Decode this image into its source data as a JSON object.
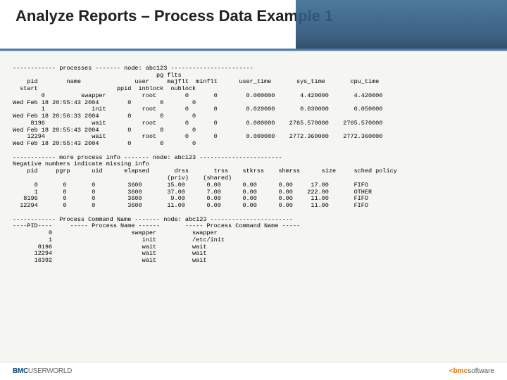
{
  "title": "Analyze Reports – Process Data Example 1",
  "block1_header": "------------ processes ------- node: abc123 -----------------------\n                                        pg flts\n    pid        name               user     majflt  minflt      user_time       sys_time       cpu_time\n  start                      ppid  inblock  oublock",
  "block1_rows": [
    "        0          swapper          root        0       0        0.000000       4.420000       4.420000\nWed Feb 18 20:55:43 2004        0        0        0",
    "        1             init          root        0       0        0.020000       0.030000       0.050000\nWed Feb 18 20:56:33 2004        0        0        0",
    "     8196             wait          root        0       0        0.000000    2765.570000    2765.570000\nWed Feb 18 20:55:43 2004        0        0        0",
    "    12294             wait          root        0       0        0.000000    2772.360000    2772.360000\nWed Feb 18 20:55:43 2004        0        0        0"
  ],
  "block2_header": "------------ more process info ------- node: abc123 -----------------------\nNegative numbers indicate missing info\n    pid     pgrp      uid      elapsed       drss       trss    stkrss    shmrss      size     sched policy\n                                           (priv)    (shared)",
  "block2_rows": [
    "      0       0       0         3600       15.00      0.00      0.00      0.00     17.00       FIFO",
    "      1       0       0         3600       37.00      7.00      0.00      0.00    222.00       OTHER",
    "   8196       0       0         3600        9.00      0.00      0.00      0.00     11.00       FIFO",
    "  12294       0       0         3600       11.00      0.00      0.00      0.00     11.00       FIFO"
  ],
  "block3_header": "------------ Process Command Name ------- node: abc123 -----------------------\n----PID----     ----- Process Name ------       ----- Process Command Name -----",
  "block3_rows": [
    "          0                      swapper          swapper",
    "          1                         init          /etc/init",
    "       8196                         wait          wait",
    "      12294                         wait          wait",
    "      16392                         wait          wait"
  ],
  "footer_left_brand": "BMC",
  "footer_left_rest": "USERWORLD",
  "footer_right_brand": "bmc",
  "footer_right_rest": "software"
}
